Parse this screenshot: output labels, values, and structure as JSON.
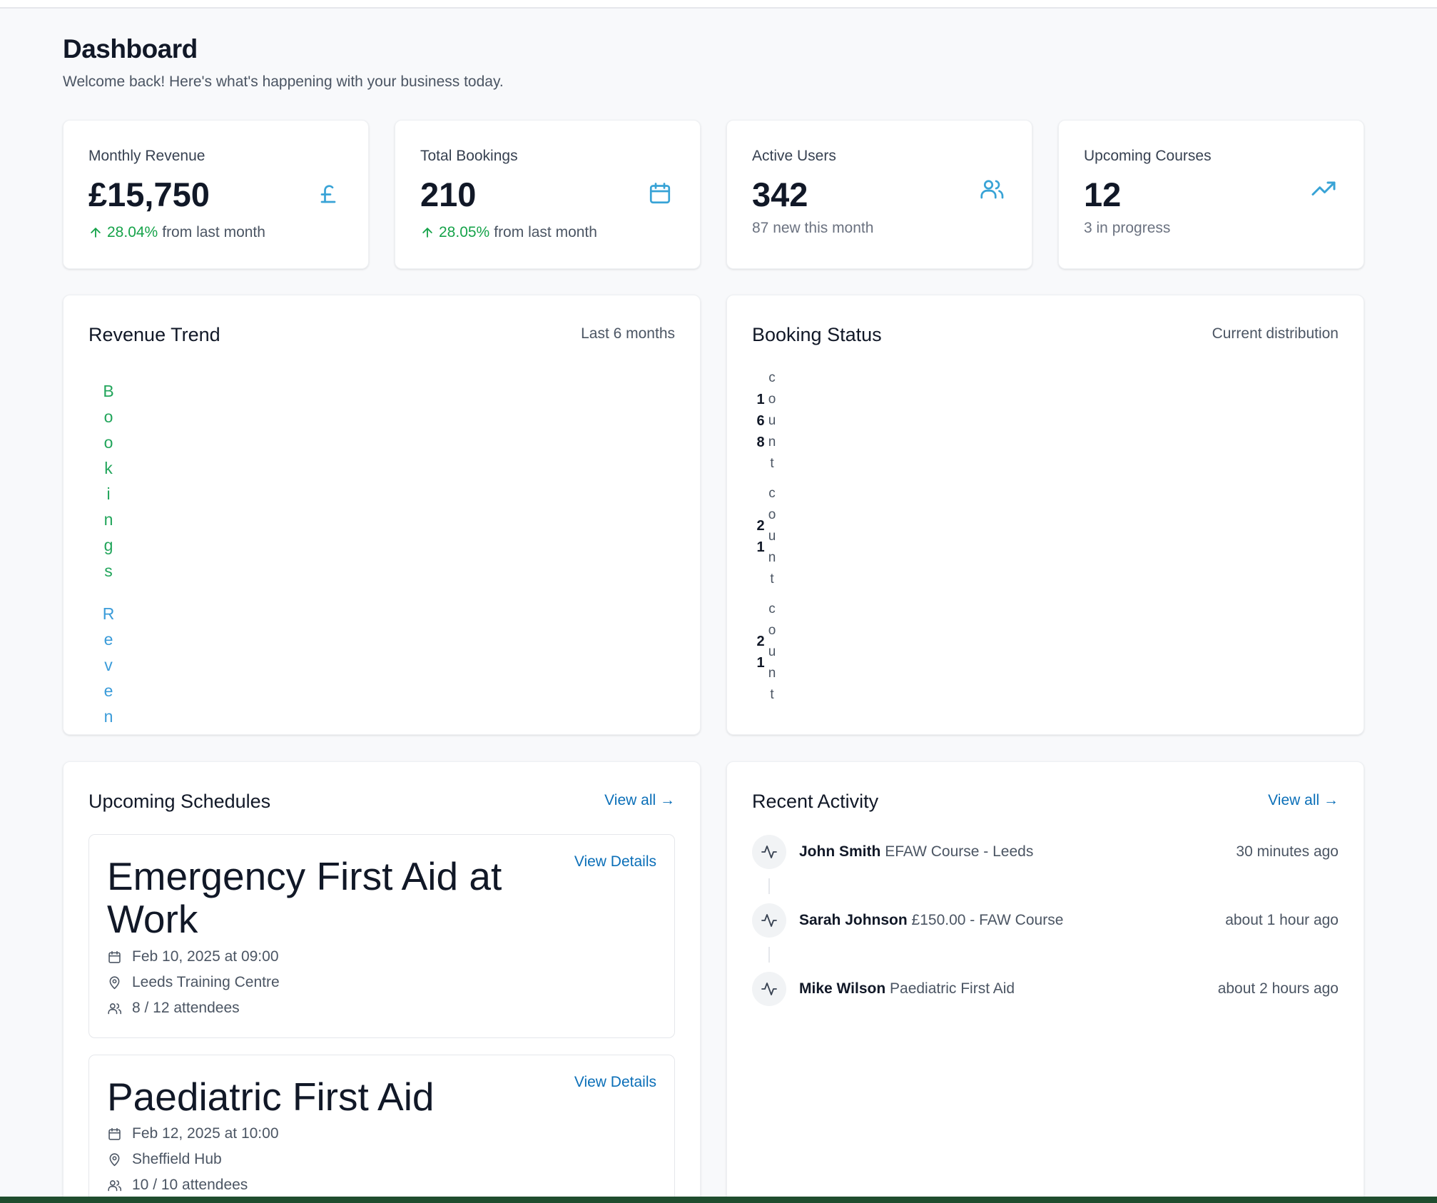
{
  "header": {
    "title": "Dashboard",
    "subtitle": "Welcome back! Here's what's happening with your business today."
  },
  "stats": [
    {
      "label": "Monthly Revenue",
      "value": "£15,750",
      "change": "28.04%",
      "change_suffix": "from last month",
      "icon": "pound-icon"
    },
    {
      "label": "Total Bookings",
      "value": "210",
      "change": "28.05%",
      "change_suffix": "from last month",
      "icon": "calendar-icon"
    },
    {
      "label": "Active Users",
      "value": "342",
      "note": "87 new this month",
      "icon": "users-icon"
    },
    {
      "label": "Upcoming Courses",
      "value": "12",
      "note": "3 in progress",
      "icon": "trending-up-icon"
    }
  ],
  "revenue_trend": {
    "title": "Revenue Trend",
    "meta": "Last 6 months",
    "legend_bookings": "Bookings",
    "legend_revenue": "Reven"
  },
  "booking_status": {
    "title": "Booking Status",
    "meta": "Current distribution",
    "groups": [
      {
        "value": "168",
        "label": "count"
      },
      {
        "value": "21",
        "label": "count"
      },
      {
        "value": "21",
        "label": "count"
      }
    ]
  },
  "schedules": {
    "title": "Upcoming Schedules",
    "view_all": "View all →",
    "items": [
      {
        "title": "Emergency First Aid at Work",
        "date": "Feb 10, 2025 at 09:00",
        "location": "Leeds Training Centre",
        "attendees": "8 / 12 attendees",
        "link": "View Details"
      },
      {
        "title": "Paediatric First Aid",
        "date": "Feb 12, 2025 at 10:00",
        "location": "Sheffield Hub",
        "attendees": "10 / 10 attendees",
        "link": "View Details"
      }
    ]
  },
  "activity": {
    "title": "Recent Activity",
    "view_all": "View all →",
    "items": [
      {
        "name": "John Smith",
        "detail": "EFAW Course - Leeds",
        "time": "30 minutes ago"
      },
      {
        "name": "Sarah Johnson",
        "detail": "£150.00 - FAW Course",
        "time": "about 1 hour ago"
      },
      {
        "name": "Mike Wilson",
        "detail": "Paediatric First Aid",
        "time": "about 2 hours ago"
      }
    ]
  },
  "colors": {
    "accent": "#0b6fb8",
    "icon": "#38a3d6",
    "positive": "#16a34a",
    "bookings_series": "#22a55b",
    "revenue_series": "#3a9bd9"
  }
}
